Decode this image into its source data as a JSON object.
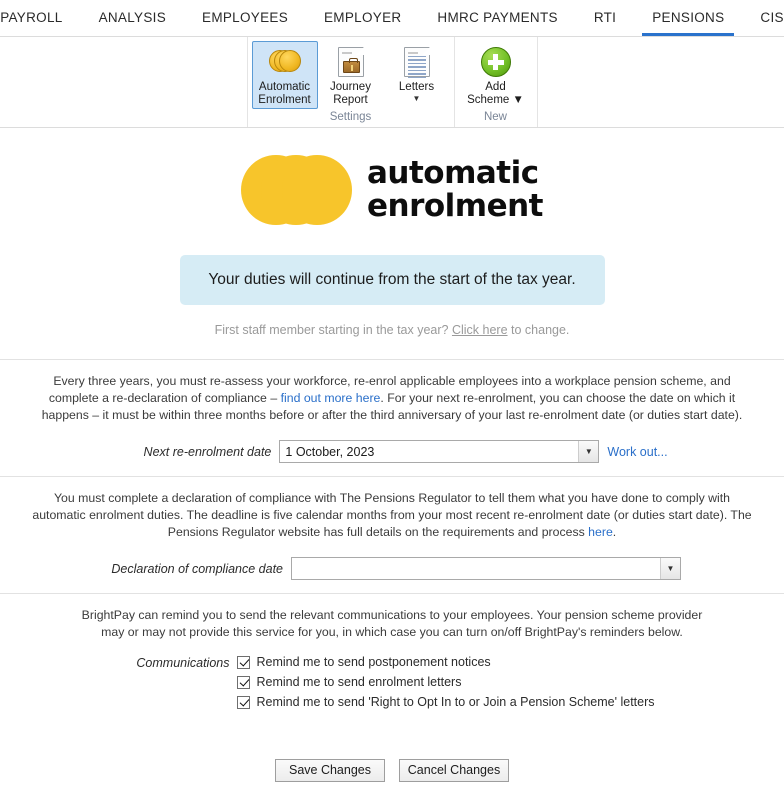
{
  "tabs": [
    {
      "label": "PAYROLL",
      "active": false
    },
    {
      "label": "ANALYSIS",
      "active": false
    },
    {
      "label": "EMPLOYEES",
      "active": false
    },
    {
      "label": "EMPLOYER",
      "active": false
    },
    {
      "label": "HMRC PAYMENTS",
      "active": false
    },
    {
      "label": "RTI",
      "active": false
    },
    {
      "label": "PENSIONS",
      "active": true
    },
    {
      "label": "CIS",
      "active": false
    }
  ],
  "ribbon": {
    "groups": [
      {
        "label": "Settings",
        "buttons": [
          {
            "line1": "Automatic",
            "line2": "Enrolment",
            "caret": "",
            "icon": "coins-icon",
            "selected": true
          },
          {
            "line1": "Journey",
            "line2": "Report",
            "caret": "",
            "icon": "briefcase-document-icon",
            "selected": false
          },
          {
            "line1": "Letters",
            "line2": "",
            "caret": "▼",
            "icon": "letters-document-icon",
            "selected": false
          }
        ]
      },
      {
        "label": "New",
        "buttons": [
          {
            "line1": "Add",
            "line2": "Scheme ▼",
            "caret": "",
            "icon": "add-plus-icon",
            "selected": false
          }
        ]
      }
    ]
  },
  "logo": {
    "line1": "automatic",
    "line2": "enrolment",
    "color": "#f7c52b"
  },
  "banner": {
    "text": "Your duties will continue from the start of the tax year.",
    "background": "#d6ecf5"
  },
  "subnote": {
    "before": "First staff member starting in the tax year? ",
    "link": "Click here",
    "after": " to change."
  },
  "reenrolment": {
    "paragraph_part1": "Every three years, you must re-assess your workforce, re-enrol applicable employees into a workplace pension scheme, and complete a re-declaration of compliance – ",
    "paragraph_link": "find out more here",
    "paragraph_part2": ". For your next re-enrolment, you can choose the date on which it happens – it must be within three months before or after the third anniversary of your last re-enrolment date (or duties start date).",
    "field_label": "Next re-enrolment date",
    "field_value": "1 October, 2023",
    "field_placeholder": "",
    "dropdown_glyph": "▼",
    "work_out_link": "Work out..."
  },
  "declaration": {
    "paragraph_part1": "You must complete a declaration of compliance with The Pensions Regulator to tell them what you have done to comply with automatic enrolment duties. The deadline is five calendar months from your most recent re-enrolment date (or duties start date). The Pensions Regulator website has full details on the requirements and process ",
    "paragraph_link": "here",
    "paragraph_part2": ".",
    "field_label": "Declaration of compliance date",
    "field_value": "",
    "field_placeholder": "",
    "dropdown_glyph": "▼"
  },
  "communications": {
    "paragraph": "BrightPay can remind you to send the relevant communications to your employees. Your pension scheme provider may or may not provide this service for you, in which case you can turn on/off BrightPay's reminders below.",
    "label": "Communications",
    "items": [
      {
        "text": "Remind me to send postponement notices",
        "checked": true
      },
      {
        "text": "Remind me to send enrolment letters",
        "checked": true
      },
      {
        "text": "Remind me to send 'Right to Opt In to or Join a Pension Scheme' letters",
        "checked": true
      }
    ]
  },
  "footer": {
    "save_label": "Save Changes",
    "cancel_label": "Cancel Changes"
  }
}
